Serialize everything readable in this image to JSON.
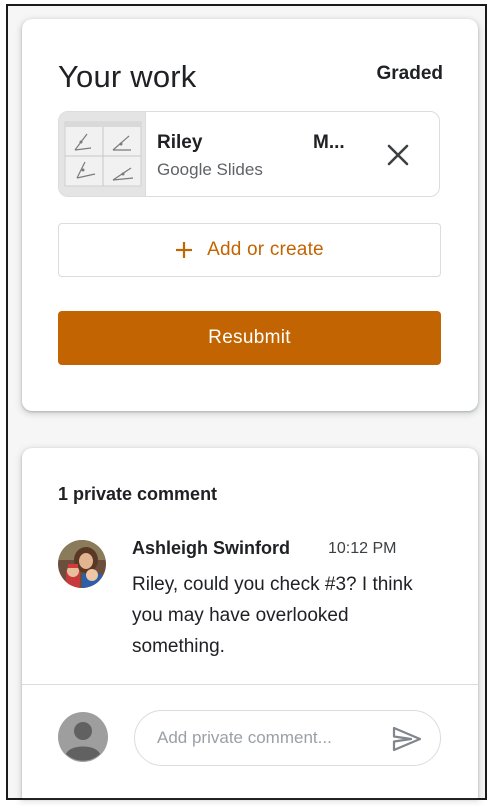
{
  "your_work": {
    "title": "Your work",
    "status": "Graded",
    "attachment": {
      "name": "Riley",
      "name_suffix": "M...",
      "type": "Google Slides",
      "thumbnail_icon": "slides-thumbnail",
      "remove_icon": "close-icon"
    },
    "add_button": {
      "icon": "plus-icon",
      "label": "Add or create"
    },
    "resubmit_label": "Resubmit"
  },
  "private_comments": {
    "heading": "1 private comment",
    "comments": [
      {
        "author": "Ashleigh Swinford",
        "time": "10:12 PM",
        "text": "Riley, could you check #3? I think you may have overlooked something.",
        "avatar_icon": "avatar-photo"
      }
    ],
    "input": {
      "placeholder": "Add private comment...",
      "value": ""
    },
    "send_icon": "send-icon"
  },
  "colors": {
    "accent": "#c26401",
    "text_primary": "#202124",
    "text_secondary": "#5f6368",
    "border": "#dadce0"
  }
}
